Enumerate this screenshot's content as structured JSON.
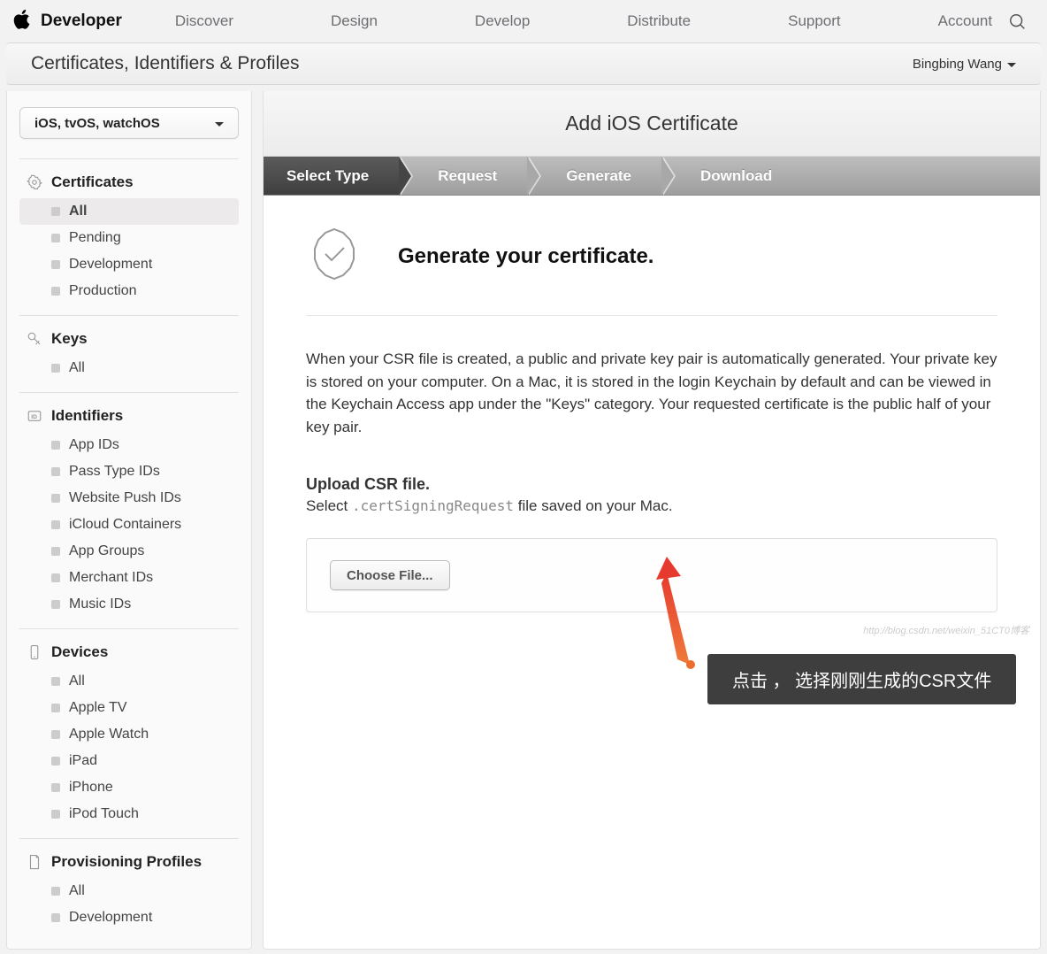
{
  "topnav": {
    "brand": "Developer",
    "items": [
      "Discover",
      "Design",
      "Develop",
      "Distribute",
      "Support",
      "Account"
    ]
  },
  "subheader": {
    "title": "Certificates, Identifiers & Profiles",
    "user": "Bingbing Wang"
  },
  "sidebar": {
    "platform": "iOS, tvOS, watchOS",
    "sections": [
      {
        "name": "Certificates",
        "items": [
          "All",
          "Pending",
          "Development",
          "Production"
        ],
        "active": 0,
        "icon": "gear"
      },
      {
        "name": "Keys",
        "items": [
          "All"
        ],
        "icon": "key"
      },
      {
        "name": "Identifiers",
        "items": [
          "App IDs",
          "Pass Type IDs",
          "Website Push IDs",
          "iCloud Containers",
          "App Groups",
          "Merchant IDs",
          "Music IDs"
        ],
        "icon": "id"
      },
      {
        "name": "Devices",
        "items": [
          "All",
          "Apple TV",
          "Apple Watch",
          "iPad",
          "iPhone",
          "iPod Touch"
        ],
        "icon": "device"
      },
      {
        "name": "Provisioning Profiles",
        "items": [
          "All",
          "Development"
        ],
        "icon": "profile"
      }
    ]
  },
  "main": {
    "title": "Add iOS Certificate",
    "steps": [
      "Select Type",
      "Request",
      "Generate",
      "Download"
    ],
    "active_step": 2,
    "heading": "Generate your certificate.",
    "description": "When your CSR file is created, a public and private key pair is automatically generated. Your private key is stored on your computer. On a Mac, it is stored in the login Keychain by default and can be viewed in the Keychain Access app under the \"Keys\" category. Your requested certificate is the public half of your key pair.",
    "upload_title": "Upload CSR file.",
    "upload_desc_pre": "Select ",
    "upload_desc_mono": ".certSigningRequest",
    "upload_desc_post": " file saved on your Mac.",
    "choose_button": "Choose File...",
    "callout": "点击 ， 选择刚刚生成的CSR文件",
    "watermark": "http://blog.csdn.net/weixin_51CT0博客"
  }
}
